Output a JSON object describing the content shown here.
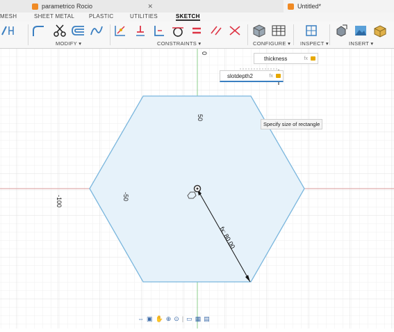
{
  "tabs": {
    "doc1": "parametrico Rocio",
    "doc2": "Untitled*"
  },
  "ribbon": {
    "categories": [
      "MESH",
      "SHEET METAL",
      "PLASTIC",
      "UTILITIES",
      "SKETCH"
    ],
    "active": "SKETCH",
    "groups": {
      "modify": "MODIFY ▾",
      "constraints": "CONSTRAINTS ▾",
      "configure": "CONFIGURE ▾",
      "inspect": "INSPECT ▾",
      "insert": "INSERT ▾"
    }
  },
  "canvas": {
    "params": [
      {
        "name": "thickness",
        "fx": "fx"
      },
      {
        "name": "slotdepth2",
        "fx": "fx"
      }
    ],
    "tooltip": "Specify size of rectangle",
    "axis_labels": {
      "zero": "0",
      "fifty": "50",
      "neg_fifty": "-50",
      "neg_hundred": "-100"
    },
    "dimension": "fx: 80.00"
  },
  "colors": {
    "accent_orange": "#f08a24",
    "sketch_fill": "#e6f2fa",
    "sketch_stroke": "#7ab6dd",
    "axis_red": "#d99a9a",
    "axis_green": "#8ccf8c",
    "grid": "#e6e6e6"
  }
}
